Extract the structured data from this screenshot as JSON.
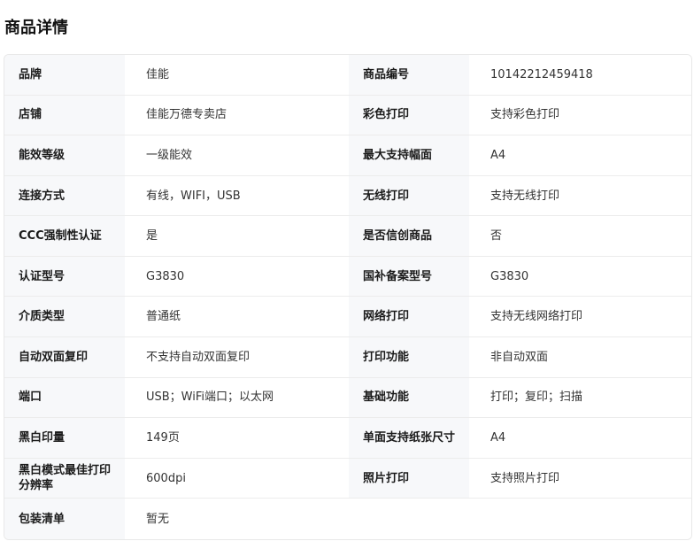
{
  "header": {
    "title": "商品详情"
  },
  "rows": [
    [
      {
        "k": "品牌",
        "v": "佳能"
      },
      {
        "k": "商品编号",
        "v": "10142212459418"
      }
    ],
    [
      {
        "k": "店铺",
        "v": "佳能万德专卖店"
      },
      {
        "k": "彩色打印",
        "v": "支持彩色打印"
      }
    ],
    [
      {
        "k": "能效等级",
        "v": "一级能效"
      },
      {
        "k": "最大支持幅面",
        "v": "A4"
      }
    ],
    [
      {
        "k": "连接方式",
        "v": "有线，WIFI，USB"
      },
      {
        "k": "无线打印",
        "v": "支持无线打印"
      }
    ],
    [
      {
        "k": "CCC强制性认证",
        "v": "是"
      },
      {
        "k": "是否信创商品",
        "v": "否"
      }
    ],
    [
      {
        "k": "认证型号",
        "v": "G3830"
      },
      {
        "k": "国补备案型号",
        "v": "G3830"
      }
    ],
    [
      {
        "k": "介质类型",
        "v": "普通纸"
      },
      {
        "k": "网络打印",
        "v": "支持无线网络打印"
      }
    ],
    [
      {
        "k": "自动双面复印",
        "v": "不支持自动双面复印"
      },
      {
        "k": "打印功能",
        "v": "非自动双面"
      }
    ],
    [
      {
        "k": "端口",
        "v": "USB；WiFi端口；以太网"
      },
      {
        "k": "基础功能",
        "v": "打印；复印；扫描"
      }
    ],
    [
      {
        "k": "黑白印量",
        "v": "149页"
      },
      {
        "k": "单面支持纸张尺寸",
        "v": "A4"
      }
    ],
    [
      {
        "k": "黑白模式最佳打印分辨率",
        "v": "600dpi"
      },
      {
        "k": "照片打印",
        "v": "支持照片打印"
      }
    ],
    [
      {
        "k": "包装清单",
        "v": "暂无"
      }
    ]
  ]
}
